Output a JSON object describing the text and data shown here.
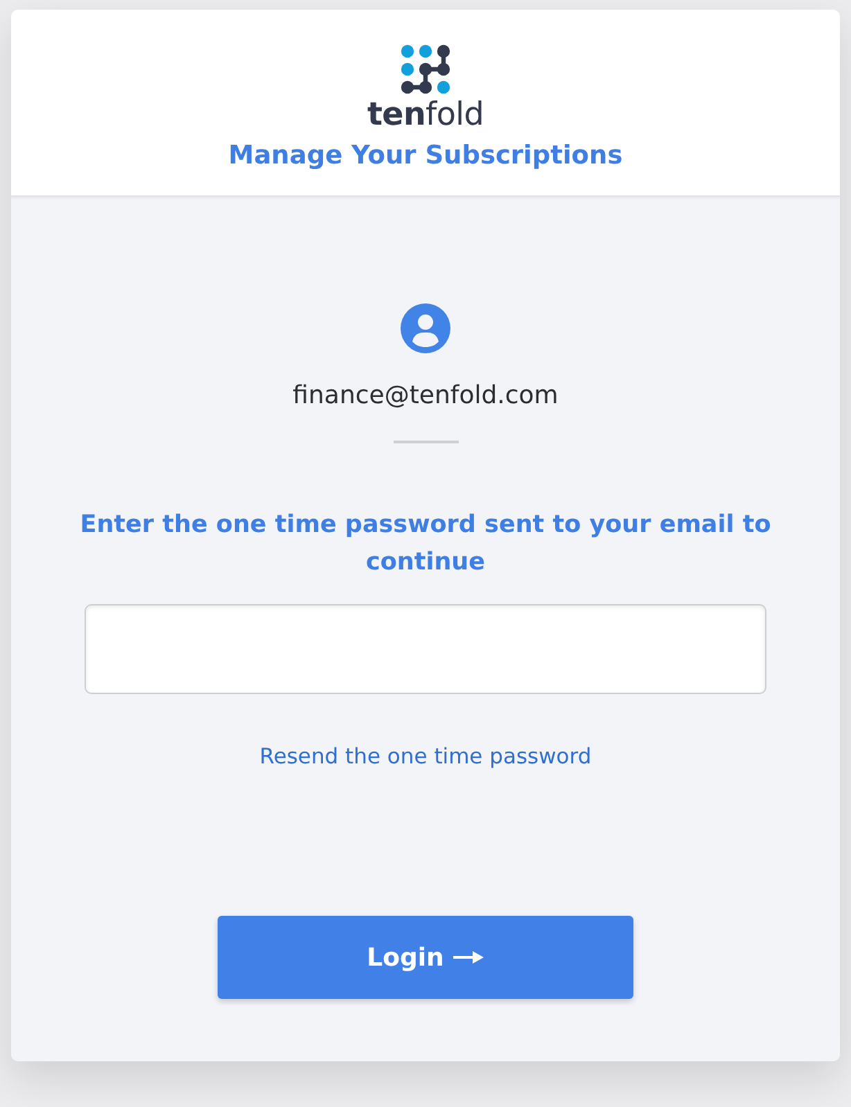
{
  "header": {
    "brand": "**ten**fold",
    "title": "Manage Your Subscriptions"
  },
  "account": {
    "email": "finance@tenfold.com"
  },
  "otp": {
    "prompt": "Enter the one time password sent to your email to continue",
    "resend_link": "Resend the one time password"
  },
  "login_button": {
    "label": "Login"
  }
}
